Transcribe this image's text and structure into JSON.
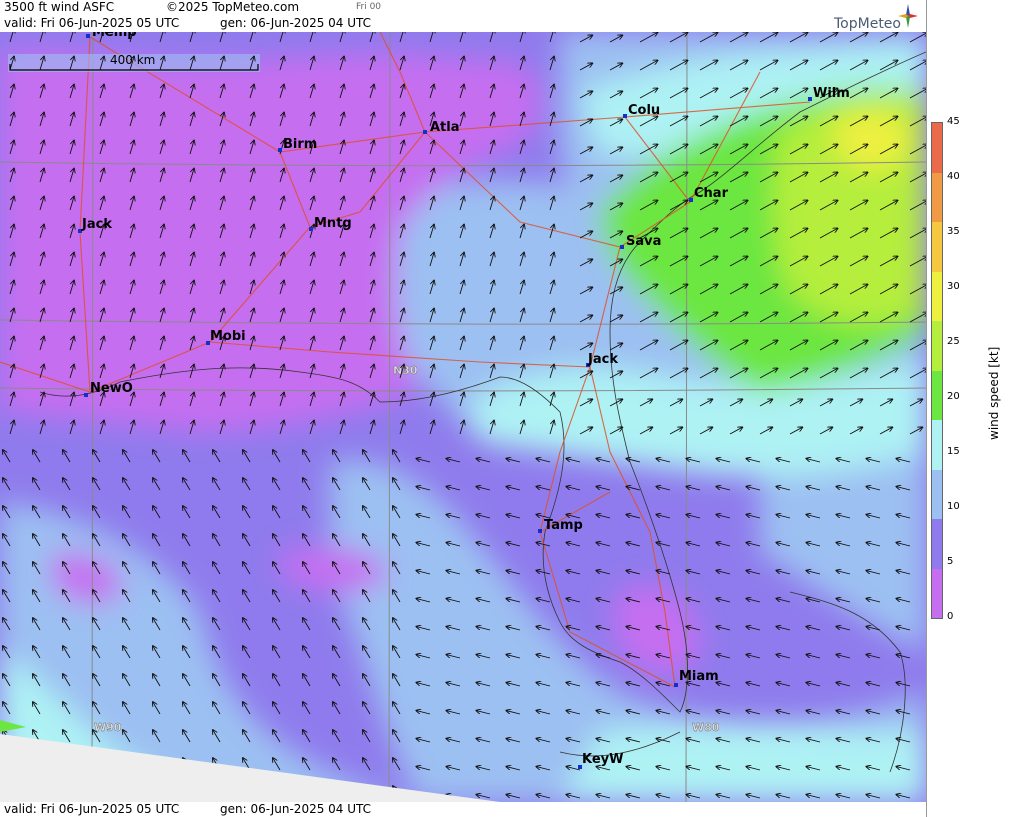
{
  "header": {
    "product": "3500 ft wind ASFC",
    "copyright": "©2025 TopMeteo.com",
    "day_small": "Fri 00",
    "valid": "valid:  Fri  06-Jun-2025  05 UTC",
    "gen": "gen: 06-Jun-2025 04 UTC",
    "brand": "TopMeteo"
  },
  "footer": {
    "valid": "valid:  Fri  06-Jun-2025  05 UTC",
    "gen": "gen: 06-Jun-2025 04 UTC"
  },
  "map": {
    "scale_label": "400 km",
    "latlon_labels": [
      "N30",
      "W90",
      "W80"
    ],
    "cities": [
      {
        "name": "Memp"
      },
      {
        "name": "Birm"
      },
      {
        "name": "Atla"
      },
      {
        "name": "Colu"
      },
      {
        "name": "Wilm"
      },
      {
        "name": "Jack"
      },
      {
        "name": "Mntg"
      },
      {
        "name": "Char"
      },
      {
        "name": "Sava"
      },
      {
        "name": "Mobi"
      },
      {
        "name": "Jack"
      },
      {
        "name": "NewO"
      },
      {
        "name": "Tamp"
      },
      {
        "name": "Miam"
      },
      {
        "name": "KeyW"
      }
    ]
  },
  "legend": {
    "title": "wind speed [kt]",
    "ticks": [
      "45",
      "40",
      "35",
      "30",
      "25",
      "20",
      "15",
      "10",
      "5",
      "0"
    ],
    "colors": [
      "#ea6a4a",
      "#f19a45",
      "#f6c840",
      "#eef040",
      "#b5ee3c",
      "#6ce640",
      "#aef2f4",
      "#9cc0f2",
      "#8f7bed",
      "#c56ef0"
    ]
  }
}
